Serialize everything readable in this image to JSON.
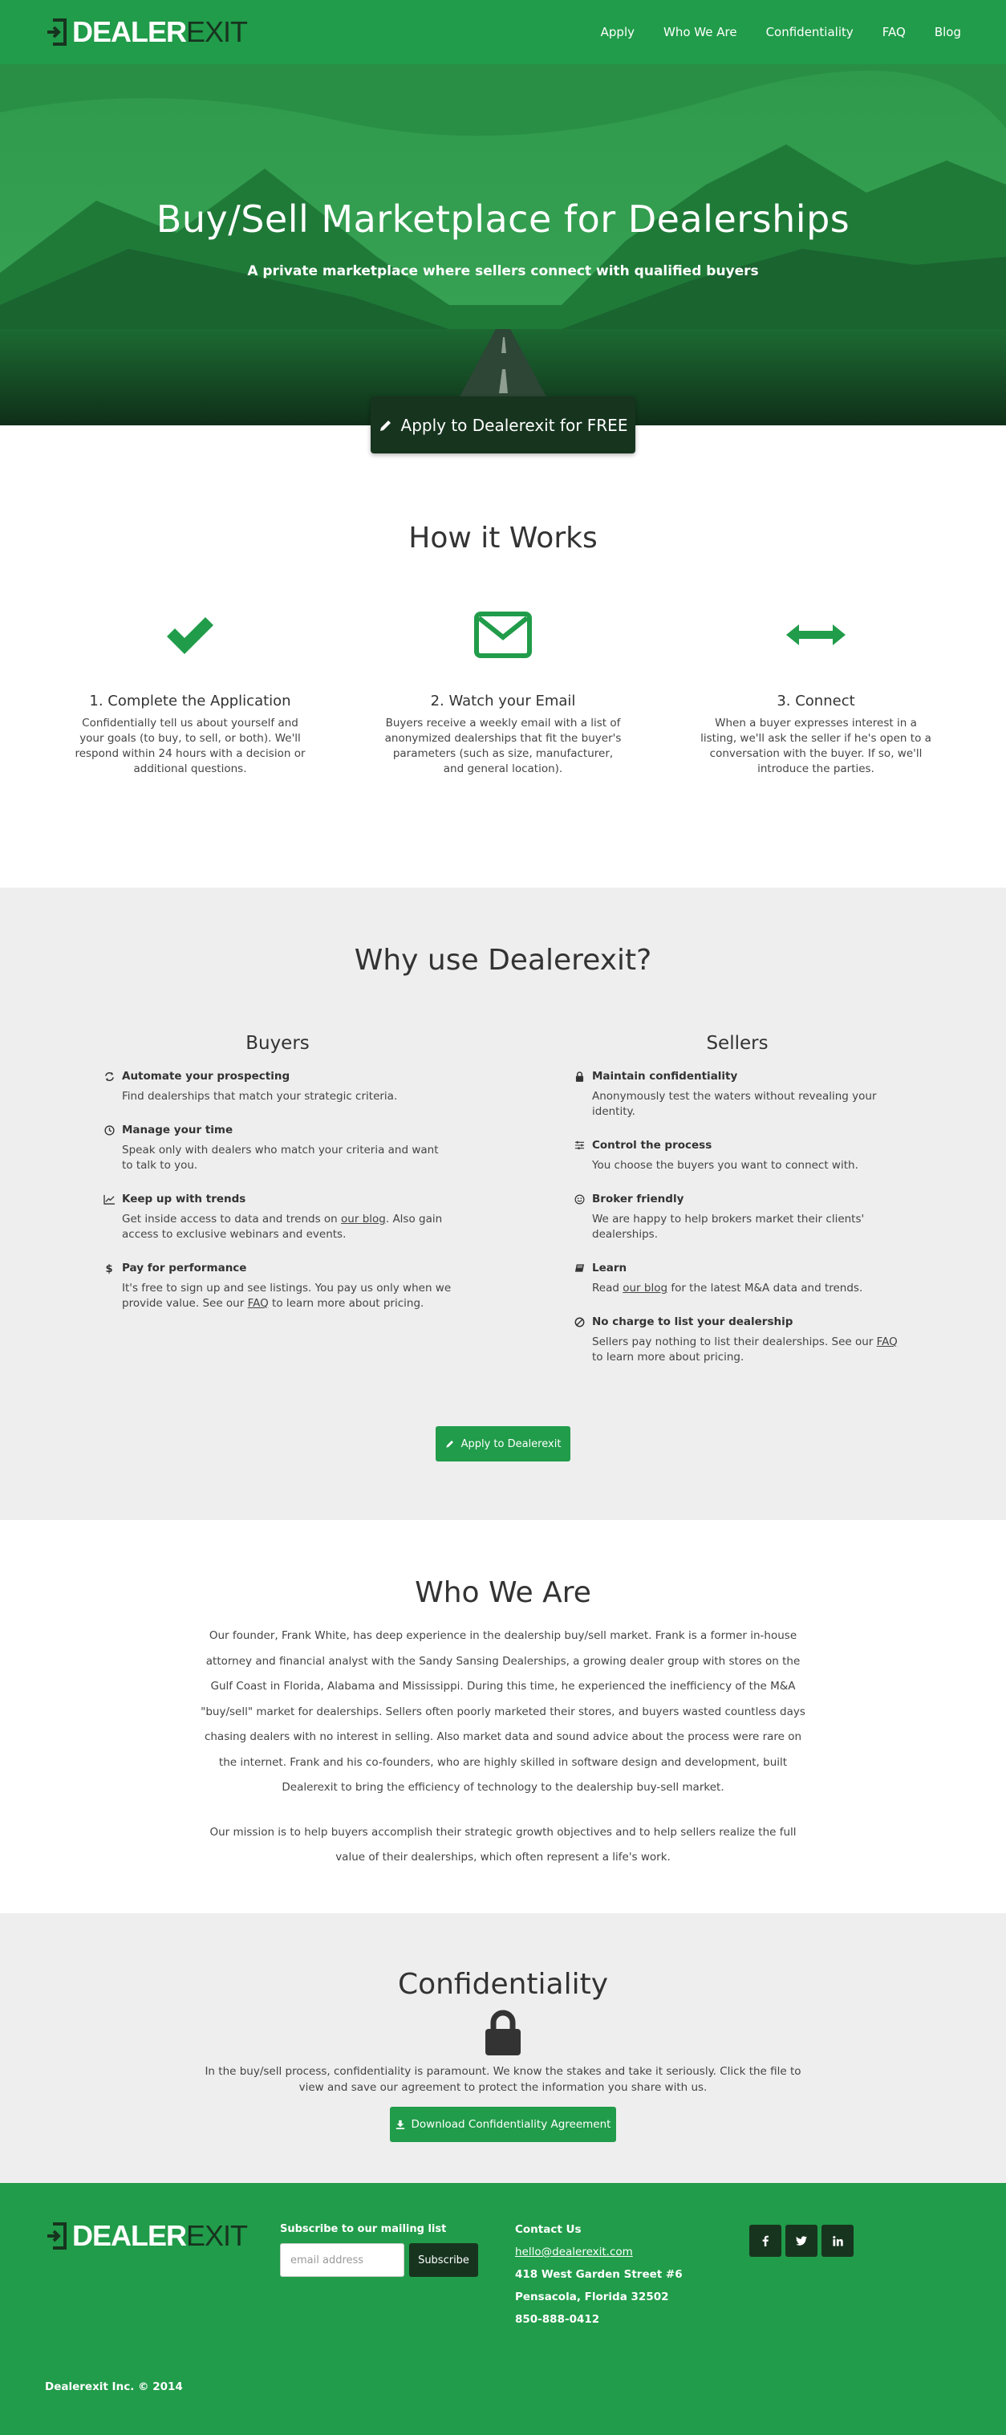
{
  "brand": {
    "logo_main": "DEALER",
    "logo_sub": "EXIT"
  },
  "colors": {
    "primary": "#219c4a",
    "dark": "#17341f",
    "gray_bg": "#eeeeee"
  },
  "nav": [
    "Apply",
    "Who We Are",
    "Confidentiality",
    "FAQ",
    "Blog"
  ],
  "hero": {
    "title": "Buy/Sell Marketplace for Dealerships",
    "subtitle": "A private marketplace where sellers connect with qualified buyers",
    "cta_label": "Apply to Dealerexit for FREE",
    "cta_icon": "pencil-icon"
  },
  "how": {
    "title": "How it Works",
    "steps": [
      {
        "icon": "check-icon",
        "title": "1. Complete the Application",
        "text": "Confidentially tell us about yourself and your goals (to buy, to sell, or both). We'll respond within 24 hours with a decision or additional questions."
      },
      {
        "icon": "envelope-icon",
        "title": "2. Watch your Email",
        "text": "Buyers receive a weekly email with a list of anonymized dealerships that fit the buyer's parameters (such as size, manufacturer, and general location)."
      },
      {
        "icon": "double-arrow-icon",
        "title": "3. Connect",
        "text": "When a buyer expresses interest in a listing, we'll ask the seller if he's open to a conversation with the buyer. If so, we'll introduce the parties."
      }
    ]
  },
  "why": {
    "title": "Why use Dealerexit?",
    "buyers": {
      "heading": "Buyers",
      "items": [
        {
          "icon": "refresh-icon",
          "title": "Automate your prospecting",
          "text": "Find dealerships that match your strategic criteria."
        },
        {
          "icon": "clock-icon",
          "title": "Manage your time",
          "text": "Speak only with dealers who match your criteria and want to talk to you."
        },
        {
          "icon": "trend-chart-icon",
          "title": "Keep up with trends",
          "text_before": "Get inside access to data and trends on ",
          "link": "our blog",
          "text_after": ". Also gain access to exclusive webinars and events."
        },
        {
          "icon": "dollar-icon",
          "title": "Pay for performance",
          "text_before": "It's free to sign up and see listings. You pay us only when we provide value. See our ",
          "link": "FAQ",
          "text_after": " to learn more about pricing."
        }
      ]
    },
    "sellers": {
      "heading": "Sellers",
      "items": [
        {
          "icon": "lock-icon",
          "title": "Maintain confidentiality",
          "text": "Anonymously test the waters without revealing your identity."
        },
        {
          "icon": "sliders-icon",
          "title": "Control the process",
          "text": "You choose the buyers you want to connect with."
        },
        {
          "icon": "smile-icon",
          "title": "Broker friendly",
          "text": "We are happy to help brokers market their clients' dealerships."
        },
        {
          "icon": "book-icon",
          "title": "Learn",
          "text_before": "Read ",
          "link": "our blog",
          "text_after": " for the latest M&A data and trends."
        },
        {
          "icon": "ban-icon",
          "title": "No charge to list your dealership",
          "text_before": "Sellers pay nothing to list their dealerships. See our ",
          "link": "FAQ",
          "text_after": " to learn more about pricing."
        }
      ]
    },
    "cta_label": "Apply to Dealerexit"
  },
  "who": {
    "title": "Who We Are",
    "p1": "Our founder, Frank White, has deep experience in the dealership buy/sell market. Frank is a former in-house attorney and financial analyst with the Sandy Sansing Dealerships, a growing dealer group with stores on the Gulf Coast in Florida, Alabama and Mississippi. During this time, he experienced the inefficiency of the M&A \"buy/sell\" market for dealerships. Sellers often poorly marketed their stores, and buyers wasted countless days chasing dealers with no interest in selling. Also market data and sound advice about the process were rare on the internet. Frank and his co-founders, who are highly skilled in software design and development, built Dealerexit to bring the efficiency of technology to the dealership buy-sell market.",
    "p2": "Our mission is to help buyers accomplish their strategic growth objectives and to help sellers realize the full value of their dealerships, which often represent a life's work."
  },
  "confidentiality": {
    "title": "Confidentiality",
    "text": "In the buy/sell process, confidentiality is paramount. We know the stakes and take it seriously. Click the file to view and save our agreement to protect the information you share with us.",
    "button_label": "Download Confidentiality Agreement"
  },
  "footer": {
    "subscribe_label": "Subscribe to our mailing list",
    "email_placeholder": "email address",
    "subscribe_button": "Subscribe",
    "contact_title": "Contact Us",
    "email": "hello@dealerexit.com",
    "address1": "418 West Garden Street #6",
    "address2": "Pensacola, Florida 32502",
    "phone": "850-888-0412",
    "social": [
      "facebook-icon",
      "twitter-icon",
      "linkedin-icon"
    ],
    "copyright": "Dealerexit Inc. © 2014"
  }
}
